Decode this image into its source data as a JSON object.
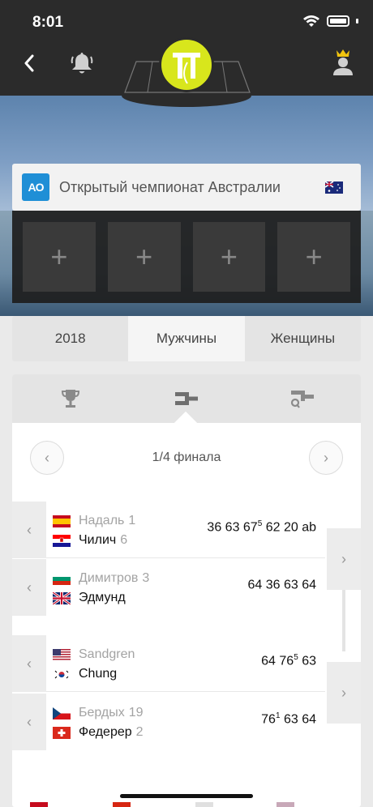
{
  "status_bar": {
    "time": "8:01"
  },
  "header": {
    "logo_icon": "tt-ball-logo",
    "back_icon": "chevron-left-icon",
    "bell_icon": "bell-icon",
    "user_icon": "crowned-user-icon"
  },
  "tournament": {
    "name": "Открытый чемпионат Австралии",
    "badge": "AO",
    "flag": "australia-flag"
  },
  "slots": [
    "+",
    "+",
    "+",
    "+"
  ],
  "segments": [
    {
      "label": "2018",
      "active": false
    },
    {
      "label": "Мужчины",
      "active": true
    },
    {
      "label": "Женщины",
      "active": false
    }
  ],
  "draw_tabs": [
    {
      "icon": "trophy-icon"
    },
    {
      "icon": "bracket-icon",
      "active": true
    },
    {
      "icon": "qualifying-bracket-icon"
    }
  ],
  "round": {
    "label": "1/4 финала",
    "prev": "‹",
    "next": "›"
  },
  "matches": [
    {
      "p1": {
        "name": "Надаль",
        "seed": "1",
        "flag": "spain",
        "winner": false
      },
      "p2": {
        "name": "Чилич",
        "seed": "6",
        "flag": "croatia",
        "winner": true
      },
      "score_parts": [
        "36 63 67",
        "5",
        " 62 20 ab"
      ]
    },
    {
      "p1": {
        "name": "Димитров",
        "seed": "3",
        "flag": "bulgaria",
        "winner": false
      },
      "p2": {
        "name": "Эдмунд",
        "seed": "",
        "flag": "uk",
        "winner": true
      },
      "score_parts": [
        "64 36 63 64",
        "",
        ""
      ]
    },
    {
      "p1": {
        "name": "Sandgren",
        "seed": "",
        "flag": "usa",
        "winner": false
      },
      "p2": {
        "name": "Chung",
        "seed": "",
        "flag": "korea",
        "winner": true
      },
      "score_parts": [
        "64 76",
        "5",
        " 63"
      ]
    },
    {
      "p1": {
        "name": "Бердых",
        "seed": "19",
        "flag": "czech",
        "winner": false
      },
      "p2": {
        "name": "Федерер",
        "seed": "2",
        "flag": "switzerland",
        "winner": true
      },
      "score_parts": [
        "76",
        "1",
        " 63 64"
      ]
    }
  ],
  "colors": {
    "header_bg": "#2b2b2b",
    "logo_yellow": "#d8e61c",
    "ao_blue": "#1f8fd6"
  }
}
